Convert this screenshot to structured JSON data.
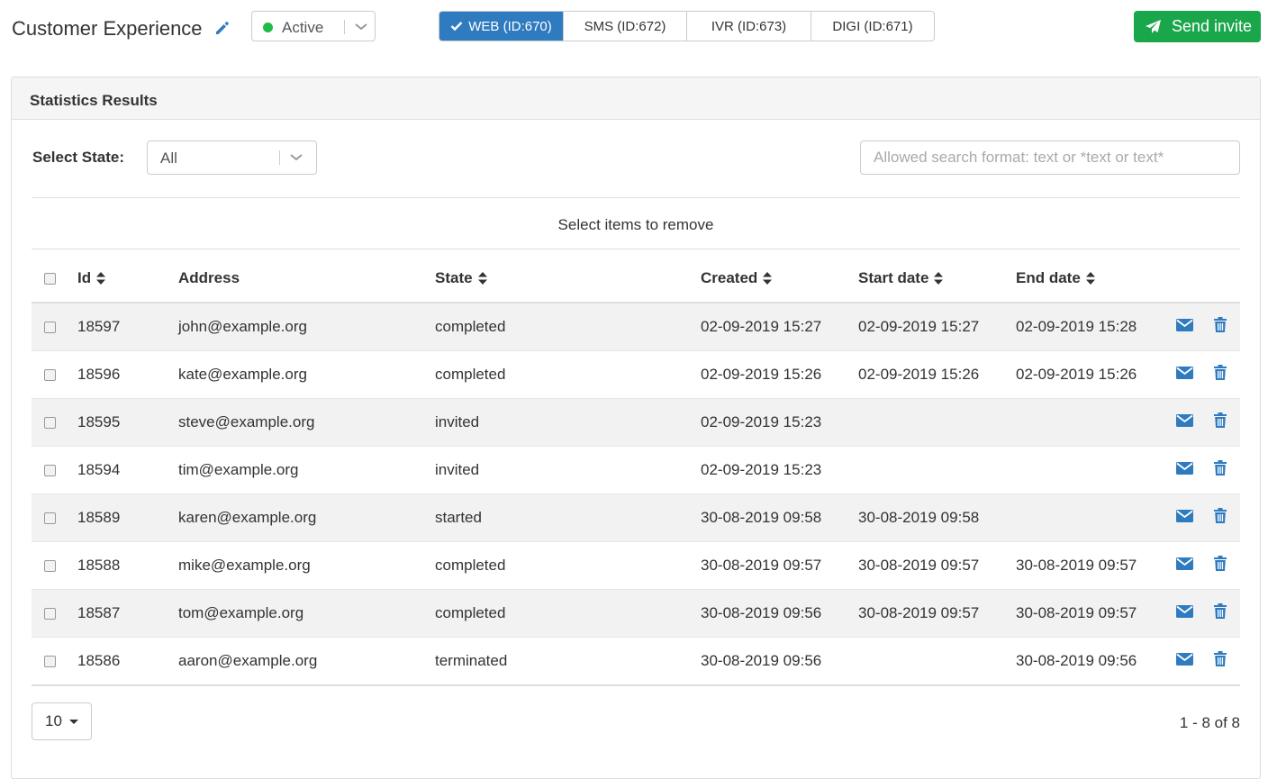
{
  "header": {
    "title": "Customer Experience",
    "status": {
      "label": "Active",
      "dot_color": "#22bb44"
    },
    "tabs": [
      {
        "label": "WEB (ID:670)",
        "active": true
      },
      {
        "label": "SMS (ID:672)",
        "active": false
      },
      {
        "label": "IVR (ID:673)",
        "active": false
      },
      {
        "label": "DIGI (ID:671)",
        "active": false
      }
    ],
    "send_button": "Send invite"
  },
  "panel": {
    "title": "Statistics Results",
    "state_filter": {
      "label": "Select State:",
      "value": "All"
    },
    "search": {
      "placeholder": "Allowed search format: text or *text or text*",
      "value": ""
    },
    "remove_message": "Select items to remove"
  },
  "table": {
    "columns": {
      "id": "Id",
      "address": "Address",
      "state": "State",
      "created": "Created",
      "start_date": "Start date",
      "end_date": "End date"
    },
    "rows": [
      {
        "id": "18597",
        "address": "john@example.org",
        "state": "completed",
        "created": "02-09-2019 15:27",
        "start": "02-09-2019 15:27",
        "end": "02-09-2019 15:28"
      },
      {
        "id": "18596",
        "address": "kate@example.org",
        "state": "completed",
        "created": "02-09-2019 15:26",
        "start": "02-09-2019 15:26",
        "end": "02-09-2019 15:26"
      },
      {
        "id": "18595",
        "address": "steve@example.org",
        "state": "invited",
        "created": "02-09-2019 15:23",
        "start": "",
        "end": ""
      },
      {
        "id": "18594",
        "address": "tim@example.org",
        "state": "invited",
        "created": "02-09-2019 15:23",
        "start": "",
        "end": ""
      },
      {
        "id": "18589",
        "address": "karen@example.org",
        "state": "started",
        "created": "30-08-2019 09:58",
        "start": "30-08-2019 09:58",
        "end": ""
      },
      {
        "id": "18588",
        "address": "mike@example.org",
        "state": "completed",
        "created": "30-08-2019 09:57",
        "start": "30-08-2019 09:57",
        "end": "30-08-2019 09:57"
      },
      {
        "id": "18587",
        "address": "tom@example.org",
        "state": "completed",
        "created": "30-08-2019 09:56",
        "start": "30-08-2019 09:57",
        "end": "30-08-2019 09:57"
      },
      {
        "id": "18586",
        "address": "aaron@example.org",
        "state": "terminated",
        "created": "30-08-2019 09:56",
        "start": "",
        "end": "30-08-2019 09:56"
      }
    ]
  },
  "pagination": {
    "per_page": "10",
    "range": "1 - 8 of 8"
  },
  "icons": {
    "edit": "pencil-icon",
    "send": "paper-plane-icon",
    "mail": "envelope-icon",
    "delete": "trash-icon",
    "check": "check-icon",
    "sort": "sort-icon"
  },
  "colors": {
    "primary": "#2f7bbf",
    "success": "#1aa64b",
    "icon_blue": "#2f7bbf"
  }
}
